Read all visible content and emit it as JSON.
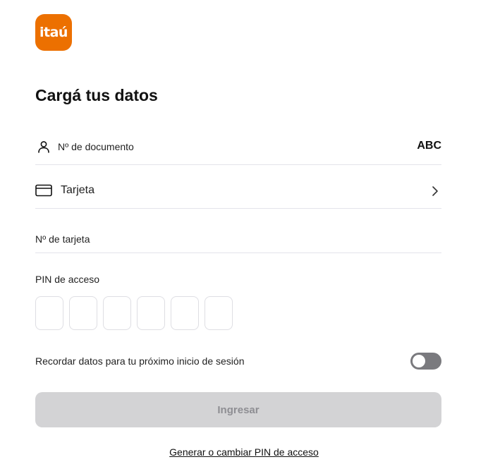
{
  "brand": {
    "logo_text": "itaú",
    "color": "#ec7000"
  },
  "page": {
    "title": "Cargá tus datos"
  },
  "document_field": {
    "label": "Nº de documento",
    "keyboard_toggle": "ABC",
    "icon": "user-icon"
  },
  "card_selector": {
    "label": "Tarjeta",
    "icon": "credit-card-icon",
    "chevron": "chevron-right-icon"
  },
  "card_number_field": {
    "label": "Nº de tarjeta",
    "value": ""
  },
  "pin": {
    "label": "PIN de acceso",
    "digits": [
      "",
      "",
      "",
      "",
      "",
      ""
    ]
  },
  "remember": {
    "label": "Recordar datos para tu próximo inicio de sesión",
    "enabled": false
  },
  "submit": {
    "label": "Ingresar",
    "enabled": false
  },
  "links": {
    "pin_link": "Generar o cambiar PIN de acceso"
  }
}
